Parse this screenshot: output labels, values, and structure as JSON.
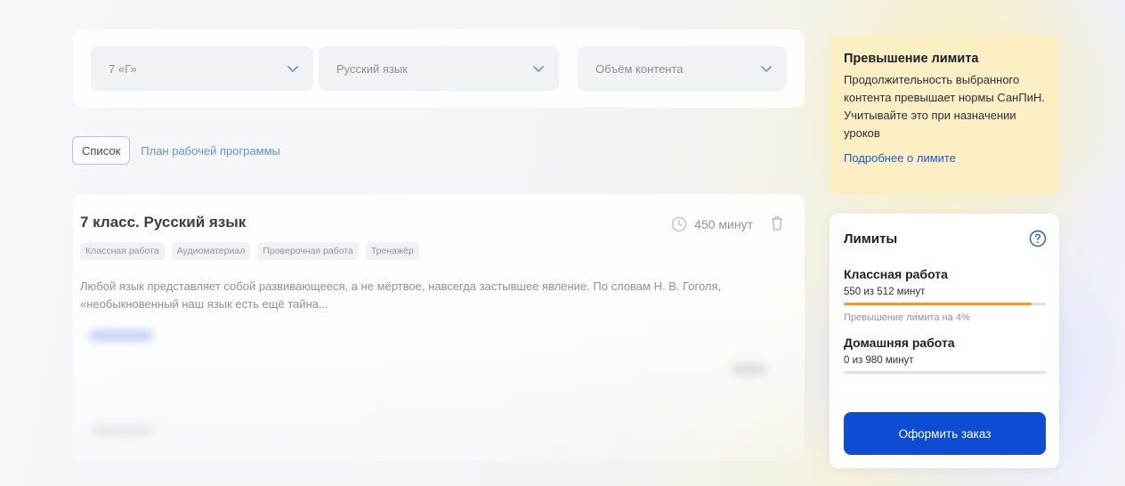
{
  "filters": {
    "class": {
      "value": "7 «Г»"
    },
    "subject": {
      "value": "Русский язык"
    },
    "volume": {
      "placeholder": "Объём контента"
    }
  },
  "tabs": {
    "list": "Список",
    "plan": "План рабочей программы"
  },
  "content": {
    "title": "7 класс. Русский язык",
    "duration": "450 минут",
    "tags": [
      "Классная работа",
      "Аудиоматериал",
      "Проверочная работа",
      "Тренажёр"
    ],
    "description": "Любой язык представляет собой развивающееся, а не мёртвое, навсегда застывшее явление. По словам Н. В. Гоголя, «необыкновенный наш язык есть ещё тайна..."
  },
  "warning": {
    "title": "Превышение лимита",
    "text": "Продолжительность выбранного контента превышает нормы СанПиН. Учитывайте это при назначении уроков",
    "link": "Подробнее о лимите"
  },
  "limits": {
    "title": "Лимиты",
    "classwork": {
      "title": "Классная работа",
      "usage": "550 из 512 минут",
      "progress": 0.93,
      "note": "Превышение лимита на 4%"
    },
    "homework": {
      "title": "Домашняя работа",
      "usage": "0 из 980 минут",
      "progress": 0
    },
    "order_button": "Оформить заказ"
  },
  "colors": {
    "accent": "#0d4cd3",
    "warning_bg": "#fcefc4",
    "progress_over": "#f59c12"
  }
}
